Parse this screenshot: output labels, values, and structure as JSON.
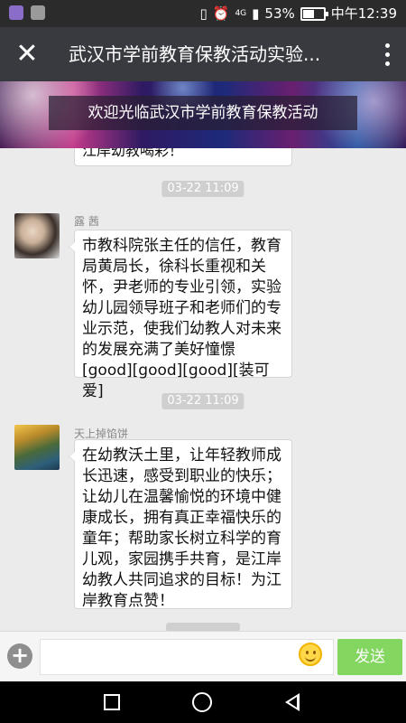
{
  "status_bar": {
    "network": "4G",
    "battery": "53%",
    "battery_level": 0.53,
    "time": "中午12:39"
  },
  "title_bar": {
    "title": "武汉市学前教育保教活动实验..."
  },
  "banner": {
    "welcome": "欢迎光临武汉市学前教育保教活动"
  },
  "chat": {
    "cut_text": "江岸幼教喝彩！",
    "messages": [
      {
        "timestamp": "03-22 11:09",
        "nickname": "露 茜",
        "text": "市教科院张主任的信任，教育局黄局长，徐科长重视和关怀，尹老师的专业引领，实验幼儿园领导班子和老师们的专业示范，使我们幼教人对未来的发展充满了美好憧憬[good][good][good][装可爱]"
      },
      {
        "timestamp": "03-22 11:09",
        "nickname": "天上掉馅饼",
        "text": "在幼教沃土里，让年轻教师成长迅速，感受到职业的快乐；让幼儿在温馨愉悦的环境中健康成长，拥有真正幸福快乐的童年；帮助家长树立科学的育儿观，家园携手共育，是江岸幼教人共同追求的目标！为江岸教育点赞！"
      }
    ]
  },
  "composer": {
    "placeholder": "",
    "send_label": "发送"
  },
  "icons": {
    "close": "close-icon",
    "more": "more-vertical-icon",
    "plus": "plus-circle-icon",
    "emoji": "emoji-icon"
  },
  "colors": {
    "title_bar": "#393a3f",
    "send_button": "#83d660",
    "chat_background": "#ebebeb"
  }
}
